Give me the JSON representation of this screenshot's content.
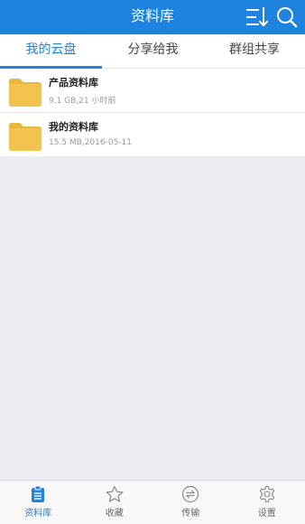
{
  "header": {
    "title": "资料库"
  },
  "tabs": [
    {
      "label": "我的云盘"
    },
    {
      "label": "分享给我"
    },
    {
      "label": "群组共享"
    }
  ],
  "files": [
    {
      "name": "产品资料库",
      "meta": "9.1 GB,21 小时前"
    },
    {
      "name": "我的资料库",
      "meta": "15.5 MB,2016-05-11"
    }
  ],
  "bottom_nav": [
    {
      "label": "资料库",
      "icon": "clipboard-icon"
    },
    {
      "label": "收藏",
      "icon": "star-icon"
    },
    {
      "label": "传输",
      "icon": "transfer-icon"
    },
    {
      "label": "设置",
      "icon": "gear-icon"
    }
  ],
  "colors": {
    "primary": "#1d83df",
    "folder": "#f2c44f",
    "background": "#ebedf2"
  }
}
